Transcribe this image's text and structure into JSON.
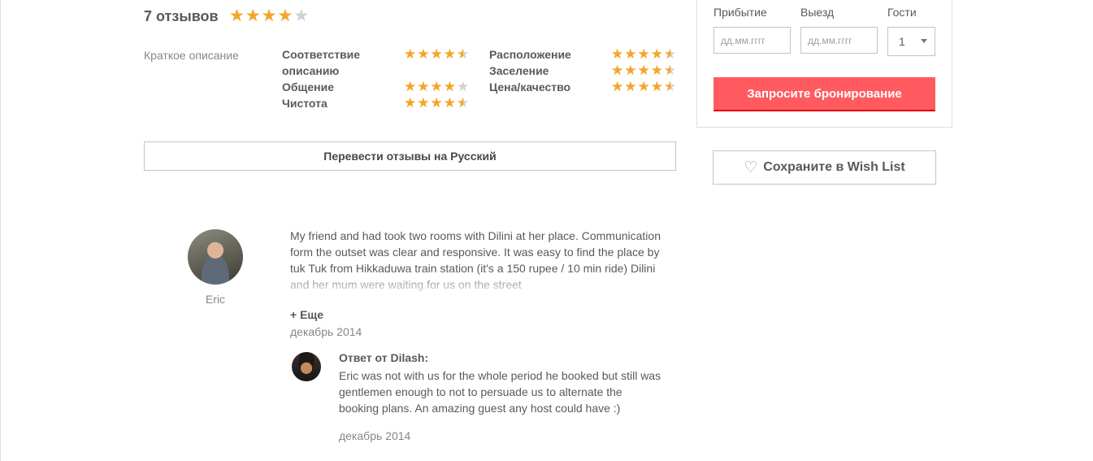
{
  "reviews": {
    "title": "7 отзывов",
    "overall_rating": 4,
    "summary_label": "Краткое описание",
    "categories": [
      {
        "label": "Соответствие\nописанию",
        "rating": 4.5
      },
      {
        "label": "Общение",
        "rating": 4
      },
      {
        "label": "Чистота",
        "rating": 4.5
      },
      {
        "label": "Расположение",
        "rating": 4.5
      },
      {
        "label": "Заселение",
        "rating": 4.5
      },
      {
        "label": "Цена/качество",
        "rating": 4.5
      }
    ],
    "translate_button": "Перевести отзывы на Русский"
  },
  "booking": {
    "checkin_label": "Прибытие",
    "checkout_label": "Выезд",
    "guests_label": "Гости",
    "checkin_placeholder": "дд.мм.гггг",
    "checkout_placeholder": "дд.мм.гггг",
    "guests_value": "1",
    "request_button": "Запросите бронирование"
  },
  "wishlist": {
    "label": "Сохраните в Wish List",
    "icon": "heart-outline-icon"
  },
  "review": {
    "author": "Eric",
    "text": "My friend and had took two rooms with Dilini at her place. Communication form the outset was clear and responsive. It was easy to find the place by tuk Tuk from Hikkaduwa train station (it's a 150 rupee / 10 min ride) Dilini and her mum were waiting for us on the street",
    "more_link": "+ Еще",
    "date": "декабрь 2014",
    "response": {
      "title": "Ответ от Dilash:",
      "text": "Eric was not with us for the whole period he booked but still was gentlemen enough to not to persuade us to alternate the booking plans. An amazing guest any host could have :)",
      "date": "декабрь 2014"
    }
  },
  "colors": {
    "star_filled": "#f5a623",
    "star_empty": "#cfd1d2",
    "brand_button": "#ff5a5f",
    "text": "#565a5c",
    "muted_text": "#82888a"
  }
}
